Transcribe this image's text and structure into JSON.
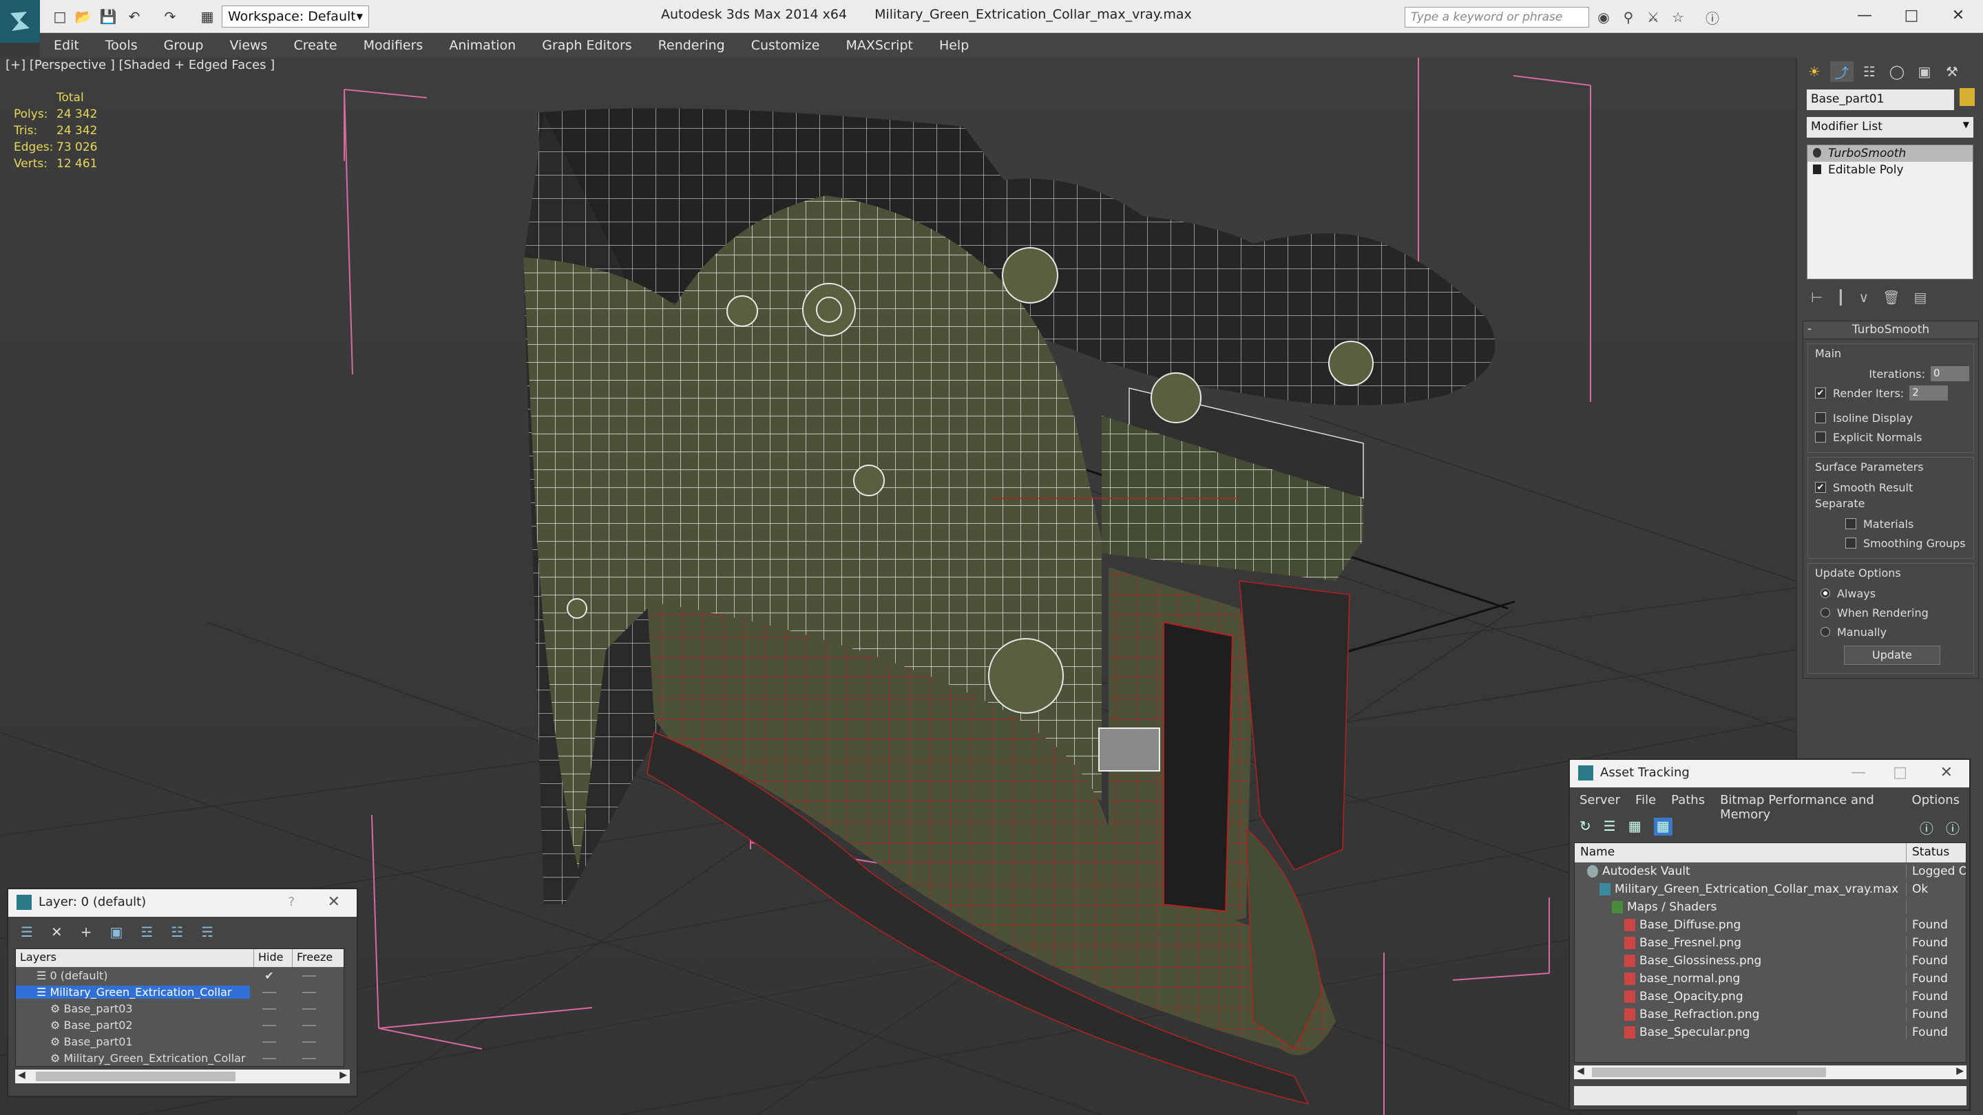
{
  "app": {
    "title_app": "Autodesk 3ds Max 2014 x64",
    "title_file": "Military_Green_Extrication_Collar_max_vray.max",
    "workspace": "Workspace: Default",
    "search_placeholder": "Type a keyword or phrase"
  },
  "menu": [
    "Edit",
    "Tools",
    "Group",
    "Views",
    "Create",
    "Modifiers",
    "Animation",
    "Graph Editors",
    "Rendering",
    "Customize",
    "MAXScript",
    "Help"
  ],
  "viewport": {
    "label": "[+] [Perspective ] [Shaded + Edged Faces ]",
    "stats_header": "Total",
    "stats": [
      {
        "label": "Polys:",
        "value": "24 342"
      },
      {
        "label": "Tris:",
        "value": "24 342"
      },
      {
        "label": "Edges:",
        "value": "73 026"
      },
      {
        "label": "Verts:",
        "value": "12 461"
      }
    ]
  },
  "command_panel": {
    "object_name": "Base_part01",
    "object_color": "#d8b030",
    "modifier_list": "Modifier List",
    "stack": [
      "TurboSmooth",
      "Editable Poly"
    ],
    "rollout_title": "TurboSmooth",
    "main_label": "Main",
    "iterations_label": "Iterations:",
    "iterations_value": "0",
    "render_iters_label": "Render Iters:",
    "render_iters_value": "2",
    "isoline_display": "Isoline Display",
    "explicit_normals": "Explicit Normals",
    "surface_params": "Surface Parameters",
    "smooth_result": "Smooth Result",
    "separate": "Separate",
    "materials": "Materials",
    "smoothing_groups": "Smoothing Groups",
    "update_options": "Update Options",
    "always": "Always",
    "when_rendering": "When Rendering",
    "manually": "Manually",
    "update_button": "Update"
  },
  "layer_dialog": {
    "title": "Layer: 0 (default)",
    "help": "?",
    "col_layers": "Layers",
    "col_hide": "Hide",
    "col_freeze": "Freeze",
    "rows": [
      {
        "name": "0 (default)",
        "indent": 1
      },
      {
        "name": "Military_Green_Extrication_Collar",
        "indent": 1
      },
      {
        "name": "Base_part03",
        "indent": 2
      },
      {
        "name": "Base_part02",
        "indent": 2
      },
      {
        "name": "Base_part01",
        "indent": 2
      },
      {
        "name": "Military_Green_Extrication_Collar",
        "indent": 2
      }
    ]
  },
  "asset_dialog": {
    "title": "Asset Tracking",
    "menu": [
      "Server",
      "File",
      "Paths",
      "Bitmap Performance and Memory",
      "Options"
    ],
    "col_name": "Name",
    "col_status": "Status",
    "rows": [
      {
        "name": "Autodesk Vault",
        "status": "Logged O",
        "type": "vault",
        "indent": 1
      },
      {
        "name": "Military_Green_Extrication_Collar_max_vray.max",
        "status": "Ok",
        "type": "max",
        "indent": 2
      },
      {
        "name": "Maps / Shaders",
        "status": "",
        "type": "folder",
        "indent": 3
      },
      {
        "name": "Base_Diffuse.png",
        "status": "Found",
        "type": "png",
        "indent": 4
      },
      {
        "name": "Base_Fresnel.png",
        "status": "Found",
        "type": "png",
        "indent": 4
      },
      {
        "name": "Base_Glossiness.png",
        "status": "Found",
        "type": "png",
        "indent": 4
      },
      {
        "name": "base_normal.png",
        "status": "Found",
        "type": "png",
        "indent": 4
      },
      {
        "name": "Base_Opacity.png",
        "status": "Found",
        "type": "png",
        "indent": 4
      },
      {
        "name": "Base_Refraction.png",
        "status": "Found",
        "type": "png",
        "indent": 4
      },
      {
        "name": "Base_Specular.png",
        "status": "Found",
        "type": "png",
        "indent": 4
      }
    ]
  }
}
